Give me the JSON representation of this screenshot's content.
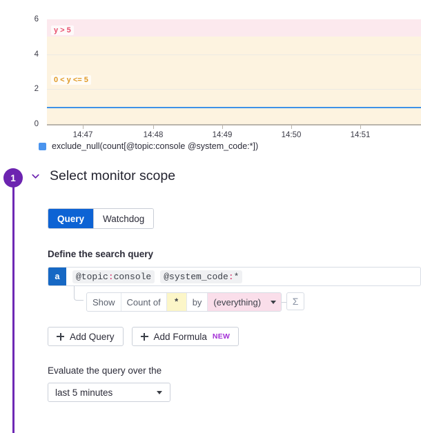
{
  "chart_data": {
    "type": "line",
    "title": "",
    "xlabel": "",
    "ylabel": "",
    "x_ticks": [
      "14:47",
      "14:48",
      "14:49",
      "14:50",
      "14:51"
    ],
    "y_ticks": [
      0,
      2,
      4,
      6
    ],
    "ylim": [
      0,
      6
    ],
    "grid": true,
    "legend_position": "bottom-left",
    "series": [
      {
        "name": "exclude_null(count[@topic:console @system_code:*])",
        "color": "#4a94ee",
        "constant_value": 1,
        "values": [
          1,
          1,
          1,
          1,
          1,
          1
        ]
      }
    ],
    "bands": [
      {
        "label": "y > 5",
        "from": 5,
        "to": 6,
        "fill": "#fce9ee",
        "line_color": "#ef8296",
        "text_color": "#e8506e"
      },
      {
        "label": "0 < y <= 5",
        "from": 0,
        "to": 5,
        "fill": "#fdf3e0",
        "line_color": "#e8a33d",
        "text_color": "#e09a27"
      }
    ]
  },
  "step": {
    "number": "1",
    "title": "Select monitor scope",
    "chevron": "chevron-down-icon",
    "accent_color": "#6c24b0"
  },
  "tabs": [
    {
      "label": "Query",
      "active": true
    },
    {
      "label": "Watchdog",
      "active": false
    }
  ],
  "query_section": {
    "heading": "Define the search query",
    "letter": "a",
    "tags": [
      {
        "key": "@topic",
        "sep": ":",
        "value": "console"
      },
      {
        "key": "@system_code",
        "sep": ":",
        "value": "*"
      }
    ],
    "aggregation": {
      "show_label": "Show",
      "count_label": "Count of",
      "measure": "*",
      "by_label": "by",
      "group_by": "(everything)",
      "sigma_label": "Σ"
    }
  },
  "actions": {
    "add_query": "Add Query",
    "add_formula": "Add Formula",
    "new_badge": "NEW"
  },
  "evaluate": {
    "label": "Evaluate the query over the",
    "selected": "last 5 minutes"
  }
}
